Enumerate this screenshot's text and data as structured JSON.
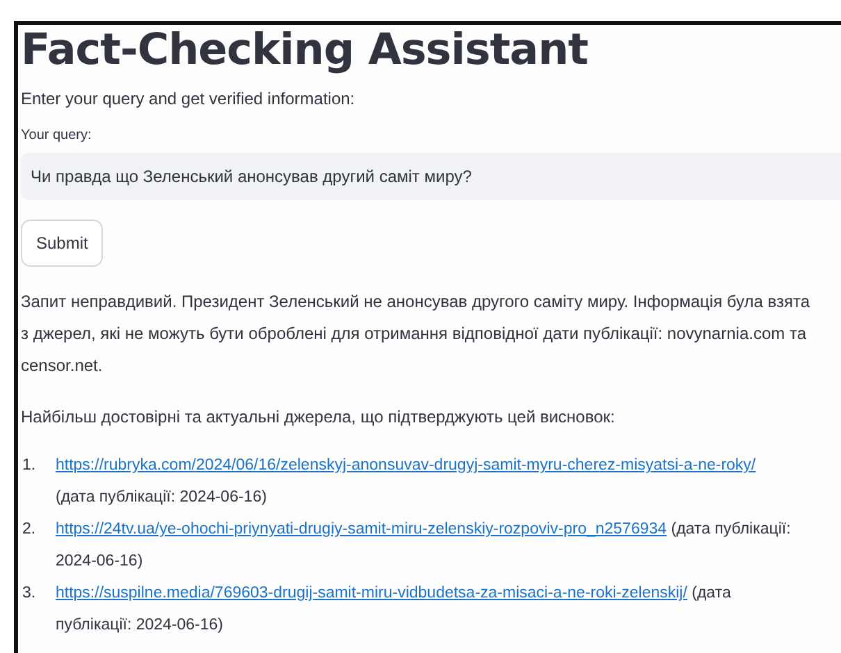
{
  "title": "Fact-Checking Assistant",
  "intro": "Enter your query and get verified information:",
  "query": {
    "label": "Your query:",
    "value": "Чи правда що Зеленський анонсував другий саміт миру?"
  },
  "submit_button": "Submit",
  "answer": "Запит неправдивий. Президент Зеленський не анонсував другого саміту миру. Інформація була взята з джерел, які не можуть бути оброблені для отримання відповідної дати публікації: novynarnia.com та censor.net.",
  "sources_heading": "Найбільш достовірні та актуальні джерела, що підтверджують цей висновок:",
  "sources": [
    {
      "number": "1.",
      "url": "https://rubryka.com/2024/06/16/zelenskyj-anonsuvav-drugyj-samit-myru-cherez-misyatsi-a-ne-roky/",
      "date": "(дата публікації: 2024-06-16)"
    },
    {
      "number": "2.",
      "url": "https://24tv.ua/ye-ohochi-priynyati-drugiy-samit-miru-zelenskiy-rozpoviv-pro_n2576934",
      "date": "(дата публікації: 2024-06-16)"
    },
    {
      "number": "3.",
      "url": "https://suspilne.media/769603-drugij-samit-miru-vidbudetsa-za-misaci-a-ne-roki-zelenskij/",
      "date": "(дата публікації: 2024-06-16)"
    }
  ]
}
